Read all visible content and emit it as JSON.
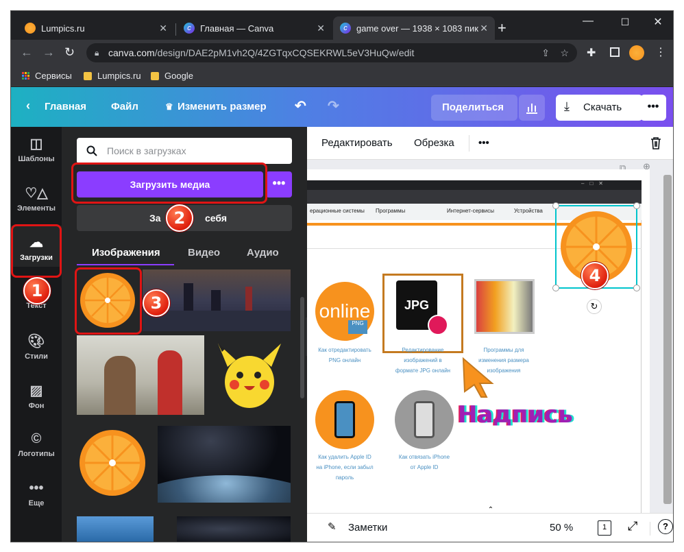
{
  "browser": {
    "tabs": [
      {
        "title": "Lumpics.ru",
        "active": false
      },
      {
        "title": "Главная — Canva",
        "active": false
      },
      {
        "title": "game over — 1938 × 1083 пик",
        "active": true
      }
    ],
    "new_tab": "+",
    "url_host": "canva.com",
    "url_path": "/design/DAE2pM1vh2Q/4ZGTqxCQSEKRWL5eV3HuQw/edit",
    "bookmarks": [
      "Сервисы",
      "Lumpics.ru",
      "Google"
    ]
  },
  "header": {
    "home": "Главная",
    "file": "Файл",
    "resize": "Изменить размер",
    "share": "Поделиться",
    "download": "Скачать",
    "more": "•••"
  },
  "rail": [
    {
      "label": "Шаблоны",
      "icon": "templates-icon"
    },
    {
      "label": "Элементы",
      "icon": "elements-icon"
    },
    {
      "label": "Загрузки",
      "icon": "upload-cloud-icon"
    },
    {
      "label": "Текст",
      "icon": "text-icon"
    },
    {
      "label": "Стили",
      "icon": "palette-icon"
    },
    {
      "label": "Фон",
      "icon": "background-icon"
    },
    {
      "label": "Логотипы",
      "icon": "logo-icon"
    },
    {
      "label": "Еще",
      "icon": "more-icon"
    }
  ],
  "panel": {
    "search_placeholder": "Поиск в загрузках",
    "upload_button": "Загрузить медиа",
    "upload_more": "•••",
    "record_left": "За",
    "record_right": "себя",
    "tabs": [
      "Изображения",
      "Видео",
      "Аудио"
    ]
  },
  "toolbar": {
    "edit": "Редактировать",
    "crop": "Обрезка",
    "more": "•••"
  },
  "canvas": {
    "bookmarks": [
      "ерационные системы",
      "Программы",
      "Интернет-сервисы",
      "Устройства"
    ],
    "cards": [
      {
        "caption": [
          "Как отредактировать",
          "PNG онлайн"
        ]
      },
      {
        "caption": [
          "Редактирование",
          "изображений в",
          "формате JPG онлайн"
        ]
      },
      {
        "caption": [
          "Программы для",
          "изменения размера",
          "изображения"
        ]
      },
      {
        "caption": [
          "Как удалить Apple ID",
          "на iPhone, если забыл",
          "пароль"
        ]
      },
      {
        "caption": [
          "Как отвязать iPhone",
          "от Apple ID"
        ]
      }
    ],
    "online_text": "online",
    "png_text": "PNG",
    "jpg_text": "JPG",
    "nadpis": "Надпись"
  },
  "bottom": {
    "notes": "Заметки",
    "zoom": "50 %",
    "page": "1",
    "help": "?"
  },
  "badges": [
    "1",
    "2",
    "3",
    "4"
  ],
  "colors": {
    "accent": "#8b3dff",
    "highlight": "#e01414",
    "orange": "#f7921e"
  }
}
